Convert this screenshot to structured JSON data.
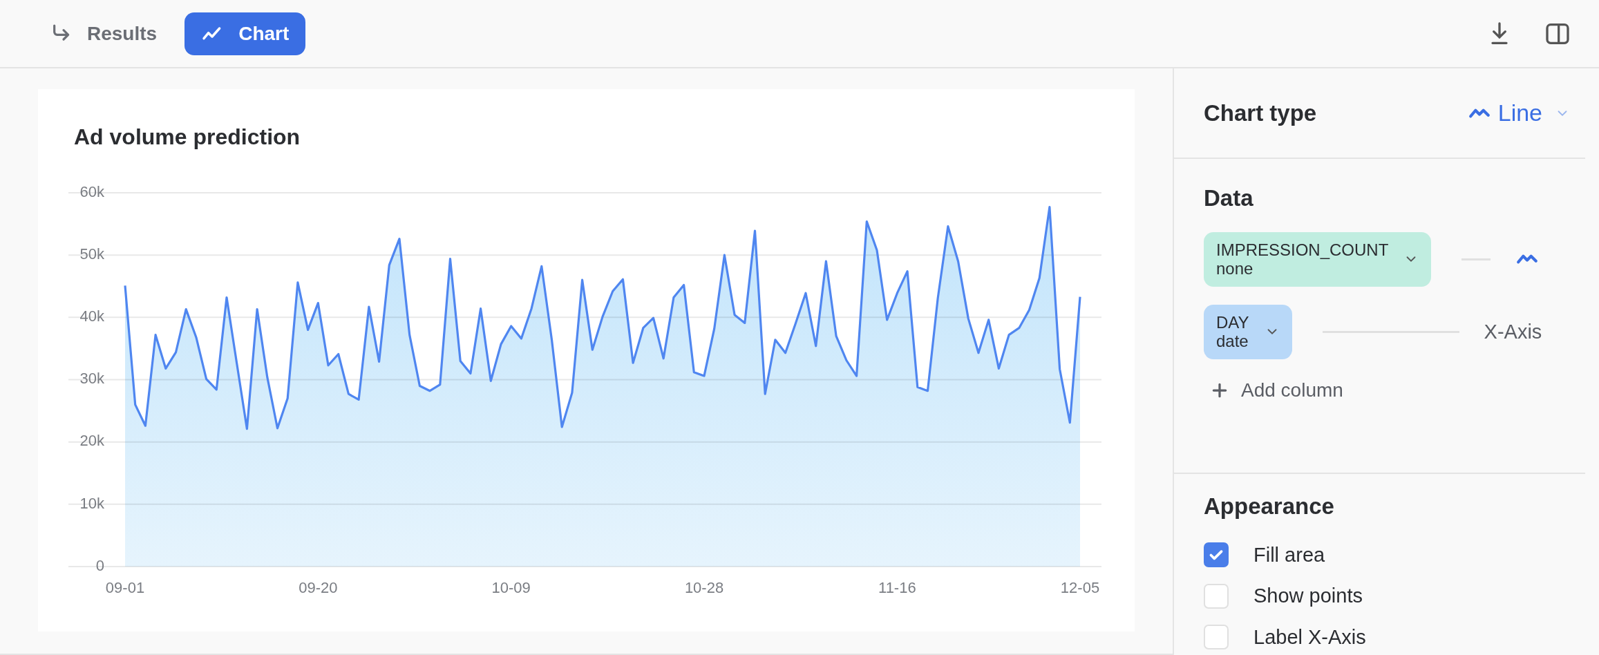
{
  "toolbar": {
    "tabs": [
      {
        "label": "Results",
        "selected": false
      },
      {
        "label": "Chart",
        "selected": true
      }
    ]
  },
  "chart": {
    "chart_data": {
      "type": "area",
      "title": "Ad volume prediction",
      "grid": true,
      "ylim": [
        0,
        60
      ],
      "categories": [
        "09-01",
        null,
        null,
        null,
        null,
        null,
        null,
        null,
        null,
        null,
        null,
        null,
        null,
        null,
        null,
        null,
        null,
        null,
        null,
        "09-20",
        null,
        null,
        null,
        null,
        null,
        null,
        null,
        null,
        null,
        null,
        null,
        null,
        null,
        null,
        null,
        null,
        null,
        null,
        "10-09",
        null,
        null,
        null,
        null,
        null,
        null,
        null,
        null,
        null,
        null,
        null,
        null,
        null,
        null,
        null,
        null,
        null,
        null,
        "10-28",
        null,
        null,
        null,
        null,
        null,
        null,
        null,
        null,
        null,
        null,
        null,
        null,
        null,
        null,
        null,
        null,
        null,
        null,
        "11-16",
        null,
        null,
        null,
        null,
        null,
        null,
        null,
        null,
        null,
        null,
        null,
        null,
        null,
        null,
        null,
        null,
        null,
        "12-05"
      ],
      "yticks": [
        {
          "value": 0,
          "label": "0"
        },
        {
          "value": 10,
          "label": "10k"
        },
        {
          "value": 20,
          "label": "20k"
        },
        {
          "value": 30,
          "label": "30k"
        },
        {
          "value": 40,
          "label": "40k"
        },
        {
          "value": 50,
          "label": "50k"
        },
        {
          "value": 60,
          "label": "60k"
        }
      ],
      "series": [
        {
          "color": "#4f86f0",
          "values": [
            45.1,
            26.0,
            22.6,
            37.2,
            31.8,
            34.4,
            41.3,
            36.8,
            30.1,
            28.4,
            43.2,
            32.6,
            22.1,
            41.3,
            30.4,
            22.2,
            27.0,
            45.6,
            38.0,
            42.3,
            32.3,
            34.1,
            27.7,
            26.8,
            41.7,
            32.9,
            48.4,
            52.6,
            37.2,
            29.0,
            28.2,
            29.2,
            49.4,
            33.0,
            31.0,
            41.4,
            29.8,
            35.7,
            38.6,
            36.6,
            41.4,
            48.2,
            36.4,
            22.4,
            27.9,
            46.0,
            34.8,
            40.1,
            44.2,
            46.1,
            32.7,
            38.3,
            39.9,
            33.4,
            43.2,
            45.2,
            31.2,
            30.6,
            38.2,
            50.0,
            40.4,
            39.1,
            53.9,
            27.7,
            36.4,
            34.3,
            39.0,
            43.9,
            35.4,
            49.0,
            37.0,
            33.1,
            30.6,
            55.4,
            50.8,
            39.6,
            43.9,
            47.4,
            28.8,
            28.2,
            43.1,
            54.6,
            49.0,
            39.8,
            34.3,
            39.6,
            31.8,
            37.2,
            38.3,
            41.2,
            46.3,
            57.7,
            31.7,
            23.1,
            43.3
          ]
        }
      ]
    }
  },
  "panel": {
    "chart_type": {
      "label": "Chart type",
      "value": "Line"
    },
    "data": {
      "heading": "Data",
      "columns": [
        {
          "kind": "series",
          "name": "IMPRESSION_COUNT",
          "type": "none",
          "color": "#c0ede0"
        },
        {
          "kind": "axis",
          "name": "DAY",
          "type": "date",
          "color": "#b8d8f8",
          "role": "X-Axis"
        }
      ],
      "add_label": "Add column"
    },
    "appearance": {
      "heading": "Appearance",
      "options": [
        {
          "label": "Fill area",
          "checked": true
        },
        {
          "label": "Show points",
          "checked": false
        },
        {
          "label": "Label X-Axis",
          "checked": false
        }
      ]
    }
  }
}
